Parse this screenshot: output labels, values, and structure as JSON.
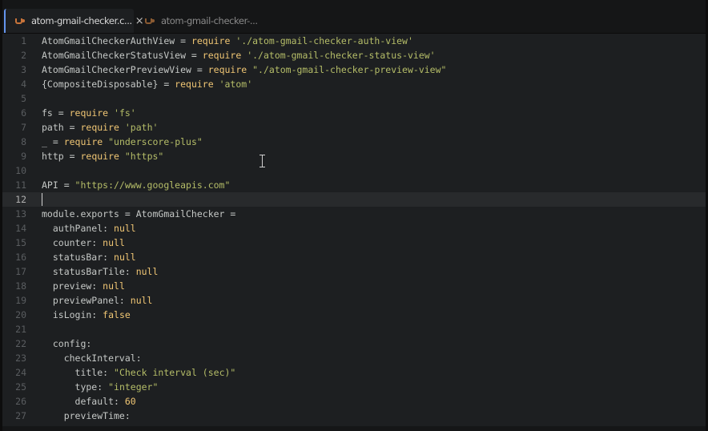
{
  "tabs": [
    {
      "label": "atom-gmail-checker.c...",
      "close": "×",
      "icon": "coffee-icon",
      "active": true
    },
    {
      "label": "atom-gmail-checker-...",
      "icon": "coffee-icon",
      "active": false
    }
  ],
  "editor": {
    "cursor_line": 12,
    "lines": [
      {
        "n": "1",
        "t": [
          [
            "AtomGmailCheckerAuthView = ",
            ""
          ],
          [
            "require",
            "kw"
          ],
          [
            " ",
            ""
          ],
          [
            "'./atom-gmail-checker-auth-view'",
            "str"
          ]
        ]
      },
      {
        "n": "2",
        "t": [
          [
            "AtomGmailCheckerStatusView = ",
            ""
          ],
          [
            "require",
            "kw"
          ],
          [
            " ",
            ""
          ],
          [
            "'./atom-gmail-checker-status-view'",
            "str"
          ]
        ]
      },
      {
        "n": "3",
        "t": [
          [
            "AtomGmailCheckerPreviewView = ",
            ""
          ],
          [
            "require",
            "kw"
          ],
          [
            " ",
            ""
          ],
          [
            "\"./atom-gmail-checker-preview-view\"",
            "str"
          ]
        ]
      },
      {
        "n": "4",
        "t": [
          [
            "{CompositeDisposable} = ",
            ""
          ],
          [
            "require",
            "kw"
          ],
          [
            " ",
            ""
          ],
          [
            "'atom'",
            "str"
          ]
        ]
      },
      {
        "n": "5",
        "t": []
      },
      {
        "n": "6",
        "t": [
          [
            "fs = ",
            ""
          ],
          [
            "require",
            "kw"
          ],
          [
            " ",
            ""
          ],
          [
            "'fs'",
            "str"
          ]
        ]
      },
      {
        "n": "7",
        "t": [
          [
            "path = ",
            ""
          ],
          [
            "require",
            "kw"
          ],
          [
            " ",
            ""
          ],
          [
            "'path'",
            "str"
          ]
        ]
      },
      {
        "n": "8",
        "t": [
          [
            "_ = ",
            ""
          ],
          [
            "require",
            "kw"
          ],
          [
            " ",
            ""
          ],
          [
            "\"underscore-plus\"",
            "str"
          ]
        ]
      },
      {
        "n": "9",
        "t": [
          [
            "http = ",
            ""
          ],
          [
            "require",
            "kw"
          ],
          [
            " ",
            ""
          ],
          [
            "\"https\"",
            "str"
          ]
        ]
      },
      {
        "n": "10",
        "t": []
      },
      {
        "n": "11",
        "t": [
          [
            "API = ",
            ""
          ],
          [
            "\"https://www.googleapis.com\"",
            "str"
          ]
        ]
      },
      {
        "n": "12",
        "t": []
      },
      {
        "n": "13",
        "t": [
          [
            "module.exports = AtomGmailChecker =",
            ""
          ]
        ]
      },
      {
        "n": "14",
        "t": [
          [
            "  authPanel: ",
            ""
          ],
          [
            "null",
            "kw"
          ]
        ]
      },
      {
        "n": "15",
        "t": [
          [
            "  counter: ",
            ""
          ],
          [
            "null",
            "kw"
          ]
        ]
      },
      {
        "n": "16",
        "t": [
          [
            "  statusBar: ",
            ""
          ],
          [
            "null",
            "kw"
          ]
        ]
      },
      {
        "n": "17",
        "t": [
          [
            "  statusBarTile: ",
            ""
          ],
          [
            "null",
            "kw"
          ]
        ]
      },
      {
        "n": "18",
        "t": [
          [
            "  preview: ",
            ""
          ],
          [
            "null",
            "kw"
          ]
        ]
      },
      {
        "n": "19",
        "t": [
          [
            "  previewPanel: ",
            ""
          ],
          [
            "null",
            "kw"
          ]
        ]
      },
      {
        "n": "20",
        "t": [
          [
            "  isLogin: ",
            ""
          ],
          [
            "false",
            "kw"
          ]
        ]
      },
      {
        "n": "21",
        "t": []
      },
      {
        "n": "22",
        "t": [
          [
            "  config:",
            ""
          ]
        ]
      },
      {
        "n": "23",
        "t": [
          [
            "    checkInterval:",
            ""
          ]
        ]
      },
      {
        "n": "24",
        "t": [
          [
            "      title: ",
            ""
          ],
          [
            "\"Check interval (sec)\"",
            "str"
          ]
        ]
      },
      {
        "n": "25",
        "t": [
          [
            "      type: ",
            ""
          ],
          [
            "\"integer\"",
            "str"
          ]
        ]
      },
      {
        "n": "26",
        "t": [
          [
            "      default: ",
            ""
          ],
          [
            "60",
            "kw"
          ]
        ]
      },
      {
        "n": "27",
        "t": [
          [
            "    previewTime:",
            ""
          ]
        ]
      }
    ]
  },
  "colors": {
    "keyword": "#f0c674",
    "string": "#b5bd68",
    "plain": "#c5c8c6",
    "accent": "#6494ed"
  }
}
